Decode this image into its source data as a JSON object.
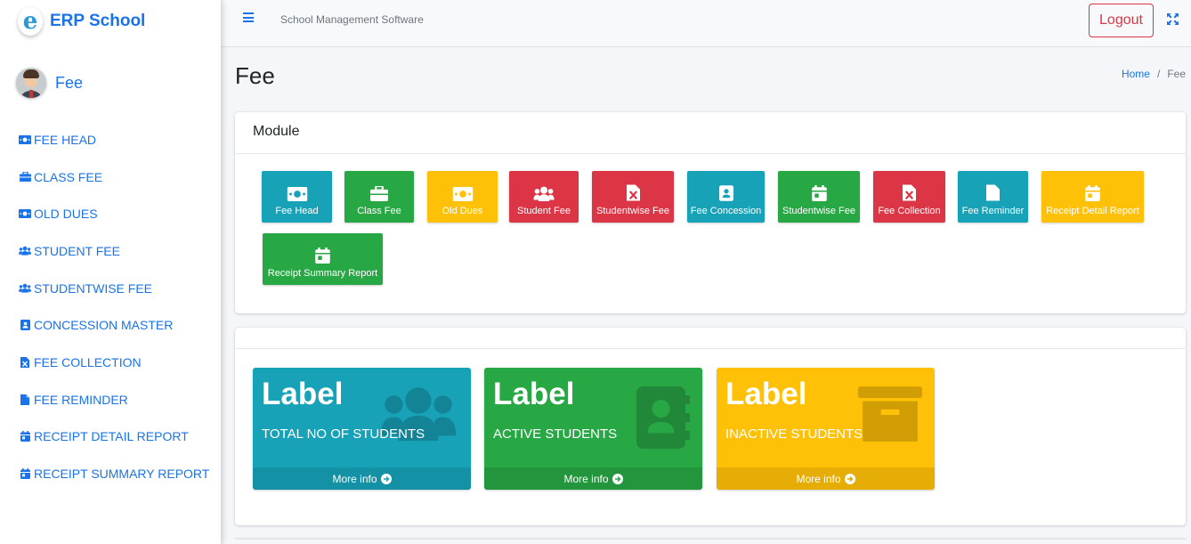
{
  "colors": {
    "primary": "#1a73e8",
    "info": "#17a2b8",
    "success": "#28a745",
    "warning": "#ffc107",
    "danger": "#dc3545"
  },
  "brand": {
    "name": "ERP School",
    "logo_letter": "e"
  },
  "user": {
    "name": "Fee"
  },
  "sidebar": {
    "items": [
      {
        "label": "FEE HEAD",
        "icon": "money-bill-icon"
      },
      {
        "label": "CLASS FEE",
        "icon": "briefcase-icon"
      },
      {
        "label": "OLD DUES",
        "icon": "money-bill-icon"
      },
      {
        "label": "STUDENT FEE",
        "icon": "users-icon"
      },
      {
        "label": "STUDENTWISE FEE",
        "icon": "users-icon"
      },
      {
        "label": "CONCESSION MASTER",
        "icon": "contact-card-icon"
      },
      {
        "label": "FEE COLLECTION",
        "icon": "excel-file-icon"
      },
      {
        "label": "FEE REMINDER",
        "icon": "file-icon"
      },
      {
        "label": "RECEIPT DETAIL REPORT",
        "icon": "calendar-icon"
      },
      {
        "label": "RECEIPT SUMMARY REPORT",
        "icon": "calendar-icon"
      }
    ]
  },
  "topbar": {
    "title": "School Management Software",
    "logout_label": "Logout"
  },
  "header": {
    "title": "Fee",
    "breadcrumb_home": "Home",
    "breadcrumb_sep": "/",
    "breadcrumb_current": "Fee"
  },
  "module": {
    "title": "Module",
    "tiles": [
      {
        "label": "Fee Head",
        "color": "info",
        "icon": "money-bill-icon"
      },
      {
        "label": "Class Fee",
        "color": "success",
        "icon": "briefcase-icon"
      },
      {
        "label": "Old Dues",
        "color": "warning",
        "icon": "money-bill-icon"
      },
      {
        "label": "Student Fee",
        "color": "danger",
        "icon": "users-icon"
      },
      {
        "label": "Studentwise Fee",
        "color": "danger",
        "icon": "excel-file-icon"
      },
      {
        "label": "Fee Concession",
        "color": "info",
        "icon": "contact-card-icon"
      },
      {
        "label": "Studentwise Fee",
        "color": "success",
        "icon": "calendar-icon"
      },
      {
        "label": "Fee Collection",
        "color": "danger",
        "icon": "excel-file-icon"
      },
      {
        "label": "Fee Reminder",
        "color": "info",
        "icon": "file-icon"
      },
      {
        "label": "Receipt Detail Report",
        "color": "warning",
        "icon": "calendar-icon"
      },
      {
        "label": "Receipt Summary Report",
        "color": "success",
        "icon": "calendar-icon"
      }
    ]
  },
  "stats": [
    {
      "value": "Label",
      "label": "TOTAL NO OF STUDENTS",
      "footer": "More info",
      "color": "info",
      "icon": "users-icon"
    },
    {
      "value": "Label",
      "label": "ACTIVE STUDENTS",
      "footer": "More info",
      "color": "success",
      "icon": "address-book-icon"
    },
    {
      "value": "Label",
      "label": "INACTIVE STUDENTS",
      "footer": "More info",
      "color": "warning",
      "icon": "archive-box-icon"
    }
  ]
}
